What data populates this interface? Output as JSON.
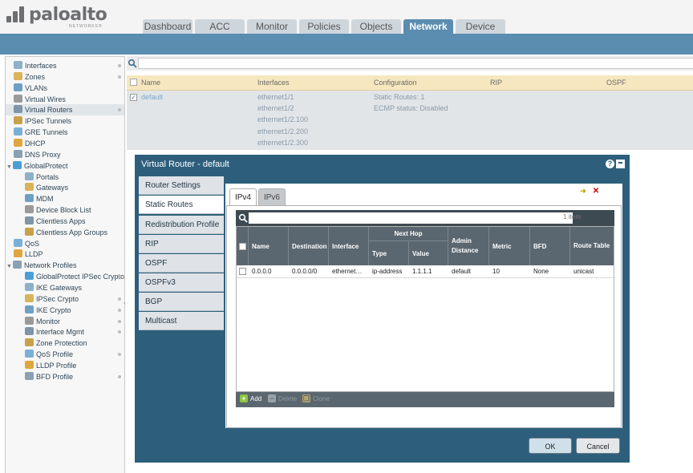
{
  "logo": {
    "word": "paloalto",
    "sub": "NETWORKS®"
  },
  "tabs": [
    "Dashboard",
    "ACC",
    "Monitor",
    "Policies",
    "Objects",
    "Network",
    "Device"
  ],
  "active_tab": "Network",
  "sidebar": {
    "items": [
      {
        "label": "Interfaces",
        "icon": "interfaces-icon",
        "dot": true,
        "indent": 0
      },
      {
        "label": "Zones",
        "icon": "zones-icon",
        "dot": true,
        "indent": 0
      },
      {
        "label": "VLANs",
        "icon": "vlans-icon",
        "dot": false,
        "indent": 0
      },
      {
        "label": "Virtual Wires",
        "icon": "virtual-wires-icon",
        "dot": false,
        "indent": 0
      },
      {
        "label": "Virtual Routers",
        "icon": "virtual-routers-icon",
        "dot": true,
        "indent": 0,
        "selected": true
      },
      {
        "label": "IPSec Tunnels",
        "icon": "ipsec-tunnels-icon",
        "dot": false,
        "indent": 0
      },
      {
        "label": "GRE Tunnels",
        "icon": "gre-tunnels-icon",
        "dot": false,
        "indent": 0
      },
      {
        "label": "DHCP",
        "icon": "dhcp-icon",
        "dot": false,
        "indent": 0
      },
      {
        "label": "DNS Proxy",
        "icon": "dns-proxy-icon",
        "dot": false,
        "indent": 0
      },
      {
        "label": "GlobalProtect",
        "icon": "globalprotect-icon",
        "dot": false,
        "indent": 0,
        "expand": "▼"
      },
      {
        "label": "Portals",
        "icon": "portals-icon",
        "dot": false,
        "indent": 1
      },
      {
        "label": "Gateways",
        "icon": "gateways-icon",
        "dot": false,
        "indent": 1
      },
      {
        "label": "MDM",
        "icon": "mdm-icon",
        "dot": false,
        "indent": 1
      },
      {
        "label": "Device Block List",
        "icon": "device-block-list-icon",
        "dot": false,
        "indent": 1
      },
      {
        "label": "Clientless Apps",
        "icon": "clientless-apps-icon",
        "dot": false,
        "indent": 1
      },
      {
        "label": "Clientless App Groups",
        "icon": "clientless-app-groups-icon",
        "dot": false,
        "indent": 1
      },
      {
        "label": "QoS",
        "icon": "qos-icon",
        "dot": false,
        "indent": 0
      },
      {
        "label": "LLDP",
        "icon": "lldp-icon",
        "dot": false,
        "indent": 0
      },
      {
        "label": "Network Profiles",
        "icon": "network-profiles-icon",
        "dot": false,
        "indent": 0,
        "expand": "▼"
      },
      {
        "label": "GlobalProtect IPSec Crypto",
        "icon": "gp-ipsec-crypto-icon",
        "dot": true,
        "indent": 1
      },
      {
        "label": "IKE Gateways",
        "icon": "ike-gateways-icon",
        "dot": false,
        "indent": 1
      },
      {
        "label": "IPSec Crypto",
        "icon": "ipsec-crypto-icon",
        "dot": true,
        "indent": 1
      },
      {
        "label": "IKE Crypto",
        "icon": "ike-crypto-icon",
        "dot": true,
        "indent": 1
      },
      {
        "label": "Monitor",
        "icon": "monitor-icon",
        "dot": true,
        "indent": 1
      },
      {
        "label": "Interface Mgmt",
        "icon": "interface-mgmt-icon",
        "dot": true,
        "indent": 1
      },
      {
        "label": "Zone Protection",
        "icon": "zone-protection-icon",
        "dot": false,
        "indent": 1
      },
      {
        "label": "QoS Profile",
        "icon": "qos-profile-icon",
        "dot": true,
        "indent": 1
      },
      {
        "label": "LLDP Profile",
        "icon": "lldp-profile-icon",
        "dot": false,
        "indent": 1
      },
      {
        "label": "BFD Profile",
        "icon": "bfd-profile-icon",
        "dot": true,
        "indent": 1
      }
    ]
  },
  "list": {
    "headers": [
      "Name",
      "Interfaces",
      "Configuration",
      "RIP",
      "OSPF"
    ],
    "row": {
      "name": "default",
      "interfaces": [
        "ethernet1/1",
        "ethernet1/2",
        "ethernet1/2.100",
        "ethernet1/2.200",
        "ethernet1/2.300"
      ],
      "configuration": [
        "Static Routes: 1",
        "ECMP status: Disabled"
      ]
    }
  },
  "dialog": {
    "title": "Virtual Router - default",
    "help": "?",
    "vtabs": [
      "Router Settings",
      "Static Routes",
      "Redistribution Profile",
      "RIP",
      "OSPF",
      "OSPFv3",
      "BGP",
      "Multicast"
    ],
    "active_vtab": "Static Routes",
    "itabs": [
      "IPv4",
      "IPv6"
    ],
    "active_itab": "IPv4",
    "count": "1 item",
    "group_header": "Next Hop",
    "columns": [
      "Name",
      "Destination",
      "Interface",
      "Type",
      "Value",
      "Admin Distance",
      "Metric",
      "BFD",
      "Route Table"
    ],
    "row": [
      "0.0.0.0",
      "0.0.0.0/0",
      "ethernet…",
      "ip-address",
      "1.1.1.1",
      "default",
      "10",
      "None",
      "unicast"
    ],
    "footer": {
      "add": "Add",
      "delete": "Delete",
      "clone": "Clone"
    },
    "ok": "OK",
    "cancel": "Cancel"
  },
  "colors": {
    "brand_blue": "#5a8db0",
    "dialog": "#2d5f7c",
    "grid_header": "#5b6770",
    "list_header": "#f6e7bf"
  }
}
